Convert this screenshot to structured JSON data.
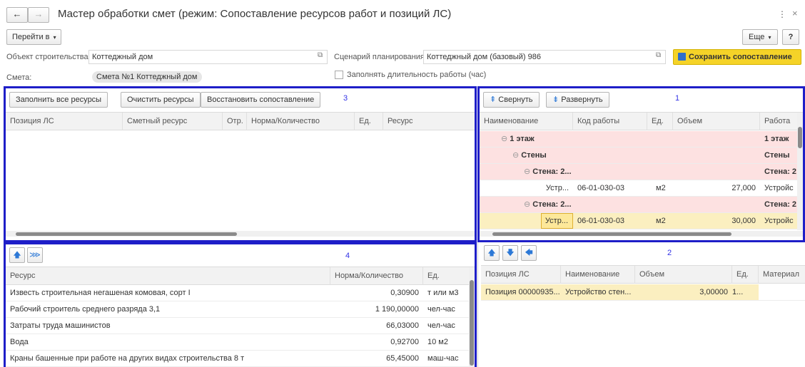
{
  "title": "Мастер обработки смет (режим: Сопоставление ресурсов работ и позиций ЛС)",
  "nav": {
    "back": "←",
    "forward": "→"
  },
  "window_controls": {
    "more": "⋮",
    "close": "×"
  },
  "toolbar": {
    "goto_label": "Перейти в",
    "more_label": "Еще",
    "help_label": "?"
  },
  "form": {
    "object_label": "Объект строительства:",
    "object_value": "Коттеджный дом",
    "scenario_label": "Сценарий планирования:",
    "scenario_value": "Коттеджный дом (базовый) 986",
    "save_label": "Сохранить сопоставление",
    "estimate_label": "Смета:",
    "estimate_value": "Смета №1 Коттеджный дом",
    "fill_duration_label": "Заполнять длительность работы (час)",
    "fill_duration_checked": false
  },
  "panel3": {
    "number": "3",
    "buttons": [
      "Заполнить все ресурсы",
      "Очистить ресурсы",
      "Восстановить сопоставление"
    ],
    "columns": [
      "Позиция ЛС",
      "Сметный ресурс",
      "Отр.",
      "Норма/Количество",
      "Ед.",
      "Ресурс"
    ],
    "rows": []
  },
  "panel1": {
    "number": "1",
    "collapse_label": "Свернуть",
    "expand_label": "Развернуть",
    "columns": [
      "Наименование",
      "Код работы",
      "Ед.",
      "Объем",
      "Работа"
    ],
    "rows": [
      {
        "name": "1 этаж",
        "code": "",
        "unit": "",
        "volume": "",
        "work": "1 этаж",
        "kind": "group"
      },
      {
        "name": "Стены",
        "code": "",
        "unit": "",
        "volume": "",
        "work": "Стены",
        "kind": "group"
      },
      {
        "name": "Стена: 2...",
        "code": "",
        "unit": "",
        "volume": "",
        "work": "Стена: 2",
        "kind": "group"
      },
      {
        "name": "Устр...",
        "code": "06-01-030-03",
        "unit": "м2",
        "volume": "27,000",
        "work": "Устройс",
        "kind": "item"
      },
      {
        "name": "Стена: 2...",
        "code": "",
        "unit": "",
        "volume": "",
        "work": "Стена: 2",
        "kind": "group"
      },
      {
        "name": "Устр...",
        "code": "06-01-030-03",
        "unit": "м2",
        "volume": "30,000",
        "work": "Устройс",
        "kind": "selected"
      }
    ]
  },
  "panel4": {
    "number": "4",
    "columns": [
      "Ресурс",
      "Норма/Количество",
      "Ед."
    ],
    "rows": [
      {
        "resource": "Известь строительная негашеная комовая, сорт I",
        "norm": "0,30900",
        "unit": "т или м3"
      },
      {
        "resource": "Рабочий строитель среднего разряда 3,1",
        "norm": "1 190,00000",
        "unit": "чел-час"
      },
      {
        "resource": "Затраты труда машинистов",
        "norm": "66,03000",
        "unit": "чел-час"
      },
      {
        "resource": "Вода",
        "norm": "0,92700",
        "unit": "10 м2"
      },
      {
        "resource": "Краны башенные при работе на других видах строительства 8 т",
        "norm": "65,45000",
        "unit": "маш-час"
      }
    ]
  },
  "panel2": {
    "number": "2",
    "columns": [
      "Позиция ЛС",
      "Наименование",
      "Объем",
      "Ед.",
      "Материал"
    ],
    "rows": [
      {
        "position": "Позиция 00000935...",
        "name": "Устройство стен...",
        "volume": "3,00000",
        "unit": "1...",
        "material": ""
      }
    ]
  },
  "colors": {
    "panel_border": "#1e1ec8",
    "group_row": "#fde1e1",
    "selected_row": "#fbefc0",
    "save_button": "#f5d328"
  }
}
